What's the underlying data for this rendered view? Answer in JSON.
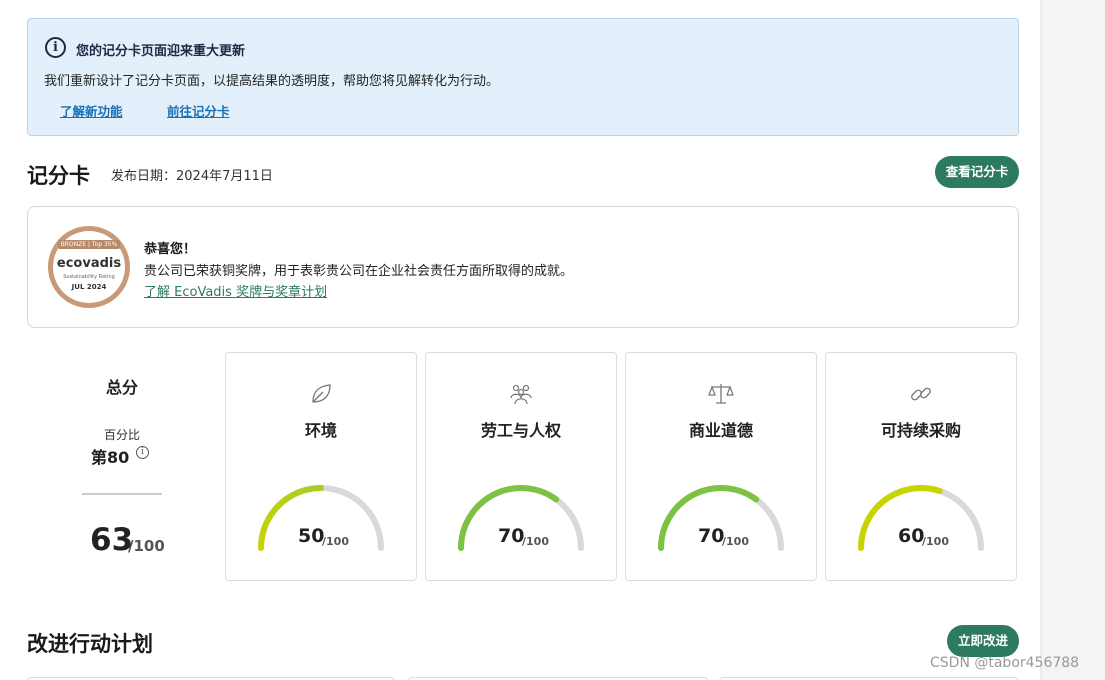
{
  "banner": {
    "title": "您的记分卡页面迎来重大更新",
    "text": "我们重新设计了记分卡页面，以提高结果的透明度，帮助您将见解转化为行动。",
    "link_features": "了解新功能",
    "link_scorecard": "前往记分卡",
    "icon": "info-icon"
  },
  "scorecard": {
    "title": "记分卡",
    "date": "发布日期：2024年7月11日",
    "view_button": "查看记分卡"
  },
  "medal": {
    "badge_top": "BRONZE | Top 35%",
    "brand": "ecovadis",
    "subtitle": "Sustainability Rating",
    "badge_date": "JUL 2024",
    "congrats": "恭喜您！",
    "description": "贵公司已荣获铜奖牌，用于表彰贵公司在企业社会责任方面所取得的成就。",
    "link": "了解 EcoVadis 奖牌与奖章计划",
    "ring_color": "#c89a78"
  },
  "overall": {
    "title": "总分",
    "percentile_label": "百分比",
    "percentile_rank": "第80",
    "score": "63",
    "max": "/100"
  },
  "categories": [
    {
      "name": "环境",
      "score": "50",
      "max": "/100",
      "value": 50,
      "icon": "leaf-icon",
      "color_start": "#c8d400",
      "color_end": "#a8cc2a"
    },
    {
      "name": "劳工与人权",
      "score": "70",
      "max": "/100",
      "value": 70,
      "icon": "people-icon",
      "color_start": "#7dc242",
      "color_end": "#7dc242"
    },
    {
      "name": "商业道德",
      "score": "70",
      "max": "/100",
      "value": 70,
      "icon": "scale-icon",
      "color_start": "#7dc242",
      "color_end": "#7dc242"
    },
    {
      "name": "可持续采购",
      "score": "60",
      "max": "/100",
      "value": 60,
      "icon": "link-icon",
      "color_start": "#c8d400",
      "color_end": "#c8d400"
    }
  ],
  "plan": {
    "title": "改进行动计划",
    "button": "立即改进"
  },
  "colors": {
    "accent": "#2c7a60",
    "banner_bg": "#e3f0fb",
    "link": "#1b6fb5",
    "gauge_track": "#d9d9d9"
  },
  "watermark": "CSDN @tabor456788"
}
